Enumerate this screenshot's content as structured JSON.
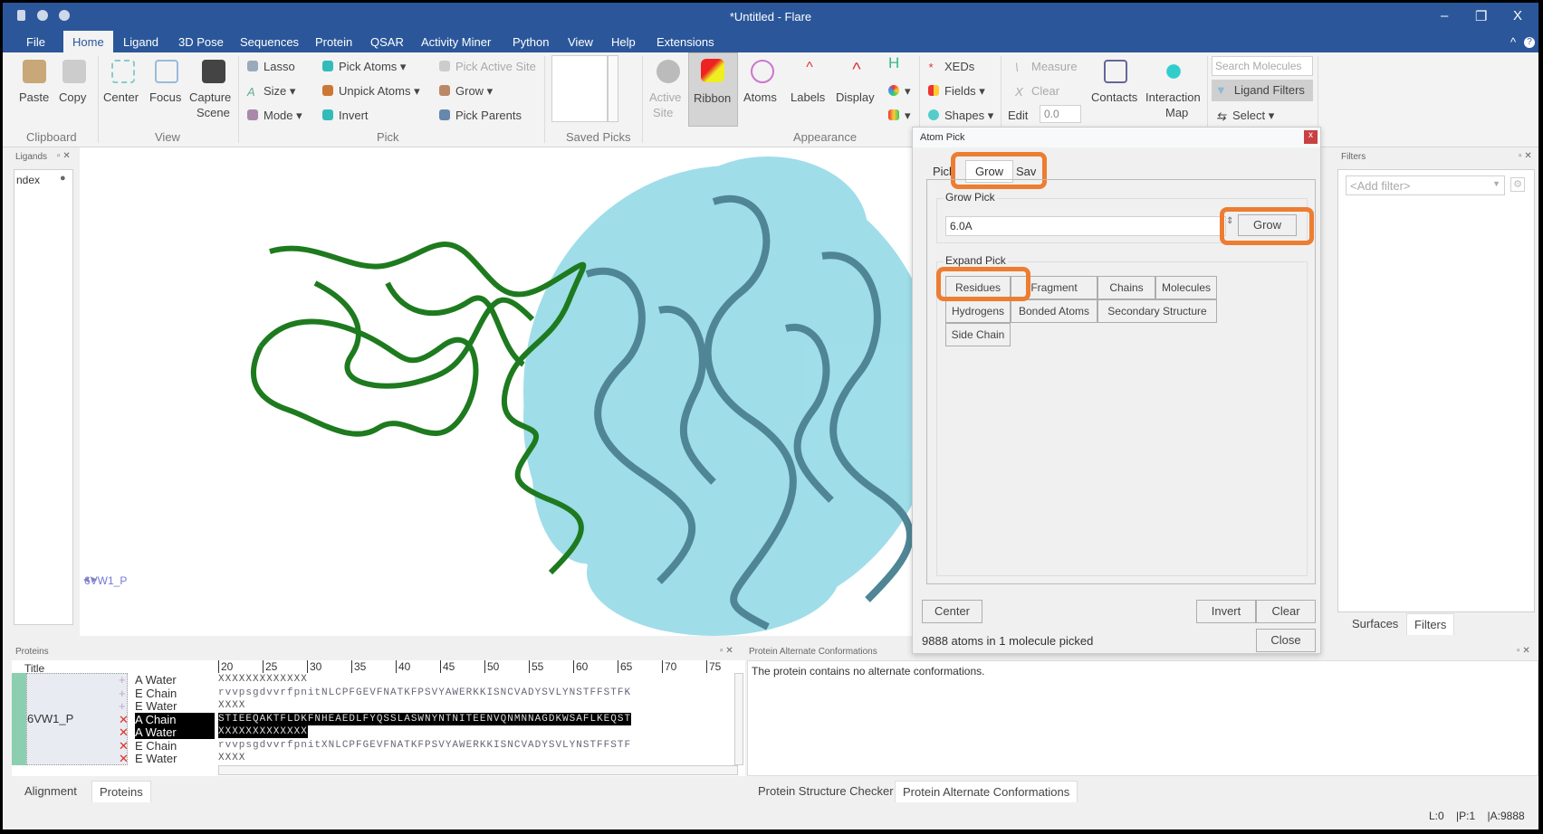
{
  "window": {
    "title": "*Untitled - Flare",
    "minimize": "–",
    "maximize": "❐",
    "close": "X",
    "collapse": "^",
    "help": "?"
  },
  "menu": [
    "File",
    "Home",
    "Ligand",
    "3D Pose",
    "Sequences",
    "Protein",
    "QSAR",
    "Activity Miner",
    "Python",
    "View",
    "Help",
    "Extensions"
  ],
  "ribbon": {
    "clipboard": {
      "label": "Clipboard",
      "paste": "Paste",
      "copy": "Copy"
    },
    "view": {
      "label": "View",
      "center": "Center",
      "focus": "Focus",
      "capture": "Capture",
      "capture2": "Scene"
    },
    "pick": {
      "label": "Pick",
      "lasso": "Lasso",
      "size": "Size",
      "mode": "Mode",
      "pick_atoms": "Pick Atoms",
      "unpick_atoms": "Unpick Atoms",
      "invert": "Invert",
      "pick_active_site": "Pick Active Site",
      "grow": "Grow",
      "pick_parents": "Pick Parents"
    },
    "saved_picks": {
      "label": "Saved Picks"
    },
    "appearance": {
      "label": "Appearance",
      "active": "Active",
      "site": "Site",
      "ribbon": "Ribbon",
      "atoms": "Atoms",
      "labels": "Labels",
      "display": "Display",
      "h": "H",
      "xeds": "XEDs",
      "fields": "Fields",
      "shapes": "Shapes"
    },
    "measure": "Measure",
    "clear": "Clear",
    "edit": "Edit",
    "edit_value": "0.0",
    "contacts": "Contacts",
    "interaction": "Interaction",
    "map": "Map",
    "search_placeholder": "Search Molecules",
    "ligand_filters": "Ligand Filters",
    "select": "Select"
  },
  "ligands_panel": {
    "title": "Ligands",
    "column": "ndex"
  },
  "viewport": {
    "label": "6VW1_P"
  },
  "atom_pick": {
    "title": "Atom Pick",
    "close": "x",
    "tabs": [
      "Pick",
      "Grow",
      "Save"
    ],
    "grow_group": "Grow Pick",
    "grow_value": "6.0A",
    "grow_button": "Grow",
    "expand_group": "Expand Pick",
    "expand_buttons": [
      "Residues",
      "Fragment",
      "Chains",
      "Molecules",
      "Hydrogens",
      "Bonded Atoms",
      "Secondary Structure",
      "Side Chain"
    ],
    "center": "Center",
    "invert": "Invert",
    "clear": "Clear",
    "close_button": "Close",
    "status": "9888 atoms in 1 molecule picked"
  },
  "filters_panel": {
    "title": "Filters",
    "placeholder": "<Add filter>",
    "tabs": [
      "Surfaces",
      "Filters"
    ]
  },
  "proteins_panel": {
    "title": "Proteins",
    "column": "Title",
    "ruler": [
      "20",
      "25",
      "30",
      "35",
      "40",
      "45",
      "50",
      "55",
      "60",
      "65",
      "70",
      "75"
    ],
    "protein": "6VW1_P",
    "rows": [
      {
        "label": "A Water",
        "seq": "XXXXXXXXXXXXX",
        "picked": false
      },
      {
        "label": "E Chain",
        "seq": "rvvpsgdvvrfpnitNLCPFGEVFNATKFPSVYAWERKKISNCVADYSVLYNSTFFSTFK",
        "picked": false
      },
      {
        "label": "E Water",
        "seq": "XXXX",
        "picked": false
      },
      {
        "label": "A Chain",
        "seq": "STIEEQAKTFLDKFNHEAEDLFYQSSLASWNYNTNITEENVQNMNNAGDKWSAFLKEQST",
        "picked": true
      },
      {
        "label": "A Water",
        "seq": "XXXXXXXXXXXXX",
        "picked": true
      },
      {
        "label": "E Chain",
        "seq": "rvvpsgdvvrfpnitXNLCPFGEVFNATKFPSVYAWERKKISNCVADYSVLYNSTFFSTF",
        "picked": true
      },
      {
        "label": "E Water",
        "seq": "XXXX",
        "picked": true
      }
    ],
    "tabs": [
      "Alignment",
      "Proteins"
    ]
  },
  "alt_conf_panel": {
    "title": "Protein Alternate Conformations",
    "message": "The protein contains no alternate conformations.",
    "tabs": [
      "Protein Structure Checker",
      "Protein Alternate Conformations"
    ]
  },
  "status_bar": {
    "l": "L:0",
    "p": "|P:1",
    "a": "|A:9888"
  },
  "colors": {
    "accent": "#2b579a",
    "highlight": "#ed7d31",
    "ligand": "#1e7a1e",
    "protein": "#5b8fa0",
    "surface": "#8fd8e6"
  }
}
